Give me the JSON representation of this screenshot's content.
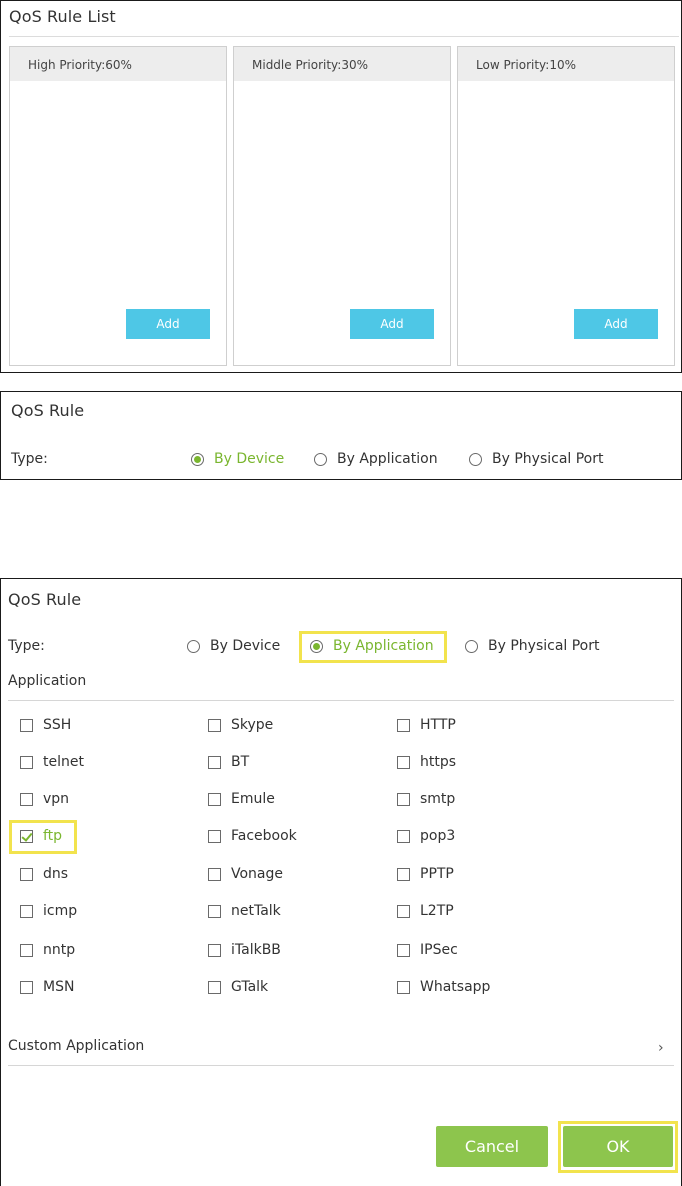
{
  "rule_list": {
    "title": "QoS Rule List",
    "columns": [
      {
        "label": "High Priority:60%",
        "button": "Add"
      },
      {
        "label": "Middle Priority:30%",
        "button": "Add"
      },
      {
        "label": "Low Priority:10%",
        "button": "Add"
      }
    ]
  },
  "rule_device": {
    "title": "QoS Rule",
    "type_label": "Type:",
    "options": [
      "By Device",
      "By Application",
      "By Physical Port"
    ],
    "selected": "By Device"
  },
  "rule_app": {
    "title": "QoS Rule",
    "type_label": "Type:",
    "options": [
      "By Device",
      "By Application",
      "By Physical Port"
    ],
    "selected": "By Application",
    "application_label": "Application",
    "apps": [
      [
        "SSH",
        "Skype",
        "HTTP"
      ],
      [
        "telnet",
        "BT",
        "https"
      ],
      [
        "vpn",
        "Emule",
        "smtp"
      ],
      [
        "ftp",
        "Facebook",
        "pop3"
      ],
      [
        "dns",
        "Vonage",
        "PPTP"
      ],
      [
        "icmp",
        "netTalk",
        "L2TP"
      ],
      [
        "nntp",
        "iTalkBB",
        "IPSec"
      ],
      [
        "MSN",
        "GTalk",
        "Whatsapp"
      ]
    ],
    "checked": [
      "ftp"
    ],
    "custom_application": "Custom Application",
    "chevron": "›",
    "cancel": "Cancel",
    "ok": "OK"
  },
  "colors": {
    "accent_green": "#7ab62f",
    "button_green": "#8dc54d",
    "add_blue": "#4ec7e6",
    "highlight_yellow": "#f2e34d"
  }
}
